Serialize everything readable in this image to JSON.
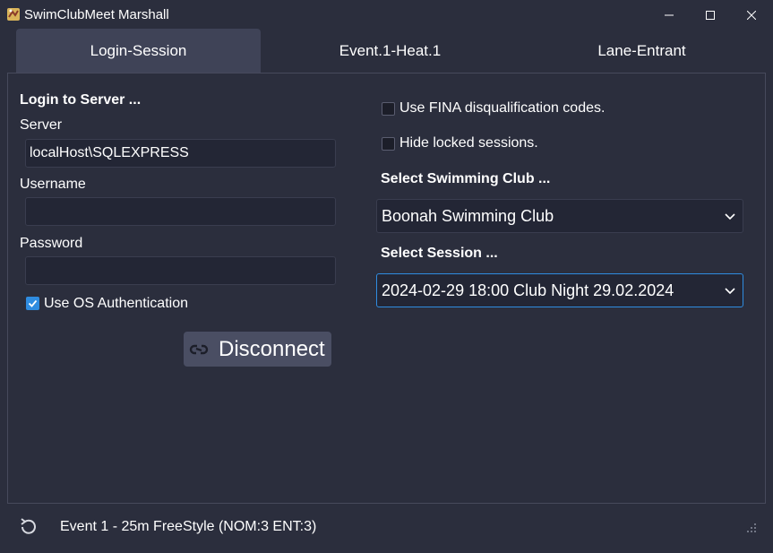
{
  "window": {
    "title": "SwimClubMeet Marshall"
  },
  "tabs": [
    {
      "label": "Login-Session"
    },
    {
      "label": "Event.1-Heat.1"
    },
    {
      "label": "Lane-Entrant"
    }
  ],
  "login": {
    "heading": "Login to Server ...",
    "server_label": "Server",
    "server_value": "localHost\\SQLEXPRESS",
    "username_label": "Username",
    "username_value": "",
    "password_label": "Password",
    "password_value": "",
    "os_auth_label": "Use OS Authentication",
    "os_auth_checked": true,
    "disconnect_label": "Disconnect"
  },
  "options": {
    "fina_label": "Use FINA disqualification codes.",
    "fina_checked": false,
    "hide_locked_label": "Hide locked sessions.",
    "hide_locked_checked": false
  },
  "club": {
    "heading": "Select Swimming Club ...",
    "selected": "Boonah Swimming Club"
  },
  "session": {
    "heading": "Select Session ...",
    "selected": "2024-02-29 18:00 Club Night 29.02.2024"
  },
  "status": {
    "text": "Event 1 - 25m FreeStyle (NOM:3 ENT:3)"
  },
  "colors": {
    "background": "#2b2e3d",
    "accent": "#2f8ce0",
    "field": "#232635",
    "button": "#4a4e63"
  },
  "icons": [
    "app-icon",
    "minimize-icon",
    "maximize-icon",
    "close-icon",
    "unlink-icon",
    "chevron-down-icon",
    "refresh-icon",
    "resize-grip-icon"
  ]
}
